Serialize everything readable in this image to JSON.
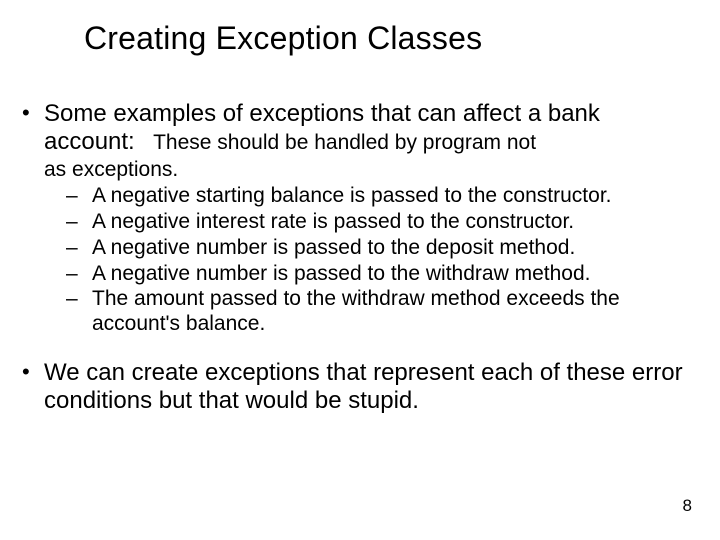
{
  "title": "Creating Exception Classes",
  "bullet1": {
    "lead": "Some examples of exceptions that can affect a bank account:",
    "note_inline": "These should be handled by program not",
    "note_continued": "as exceptions.",
    "subitems": [
      "A negative starting balance is passed to the constructor.",
      "A negative interest rate is passed to the constructor.",
      "A negative number is passed to the deposit method.",
      "A negative number is passed to the withdraw method.",
      "The amount passed to the withdraw method exceeds the account's balance."
    ]
  },
  "bullet2": "We can create exceptions that represent each of these error conditions but that would be stupid.",
  "page_number": "8"
}
